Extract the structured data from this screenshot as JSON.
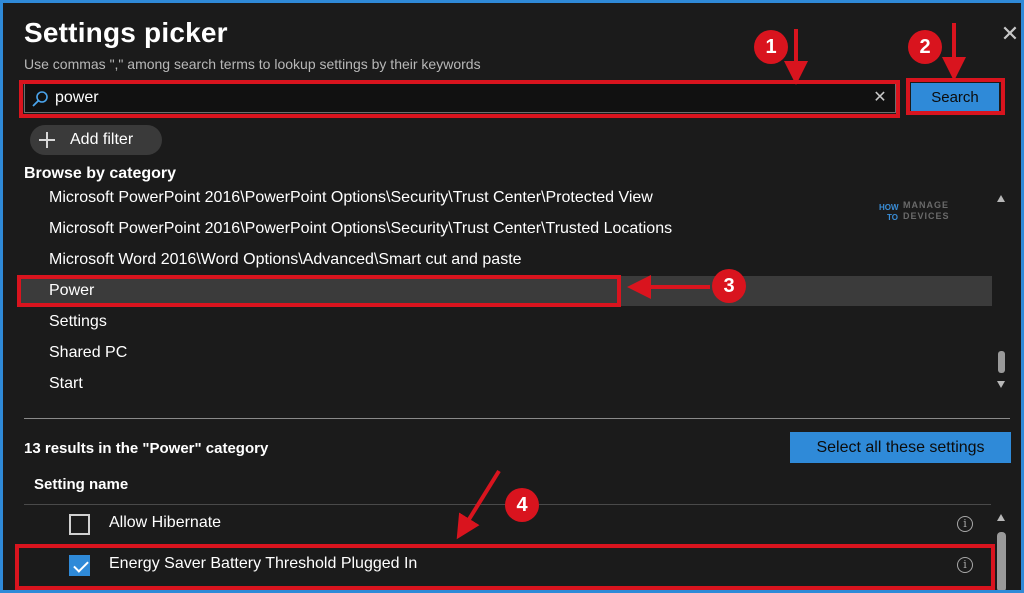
{
  "dialog": {
    "title": "Settings picker",
    "subtitle": "Use commas \",\" among search terms to lookup settings by their keywords",
    "close_icon": "close-icon"
  },
  "search": {
    "value": "power",
    "placeholder": "",
    "button_label": "Search",
    "icon": "search-icon",
    "clear_icon": "clear-icon"
  },
  "filter": {
    "add_label": "Add filter"
  },
  "browse": {
    "label": "Browse by category",
    "items": [
      {
        "label": "Microsoft PowerPoint 2016\\PowerPoint Options\\Security\\Trust Center\\Protected View",
        "selected": false
      },
      {
        "label": "Microsoft PowerPoint 2016\\PowerPoint Options\\Security\\Trust Center\\Trusted Locations",
        "selected": false
      },
      {
        "label": "Microsoft Word 2016\\Word Options\\Advanced\\Smart cut and paste",
        "selected": false
      },
      {
        "label": "Power",
        "selected": true
      },
      {
        "label": "Settings",
        "selected": false
      },
      {
        "label": "Shared PC",
        "selected": false
      },
      {
        "label": "Start",
        "selected": false
      }
    ]
  },
  "results": {
    "count_text": "13 results in the \"Power\" category",
    "select_all_label": "Select all these settings",
    "column_header": "Setting name",
    "rows": [
      {
        "name": "Allow Hibernate",
        "checked": false
      },
      {
        "name": "Energy Saver Battery Threshold Plugged In",
        "checked": true
      }
    ]
  },
  "annotations": {
    "badges": [
      "1",
      "2",
      "3",
      "4"
    ]
  },
  "watermark": {
    "line1": "HOW",
    "line2": "TO",
    "line3": "MANAGE",
    "line4": "DEVICES"
  },
  "colors": {
    "accent": "#2f8ad8",
    "annotation": "#d9141e",
    "background": "#1b1b1b"
  }
}
